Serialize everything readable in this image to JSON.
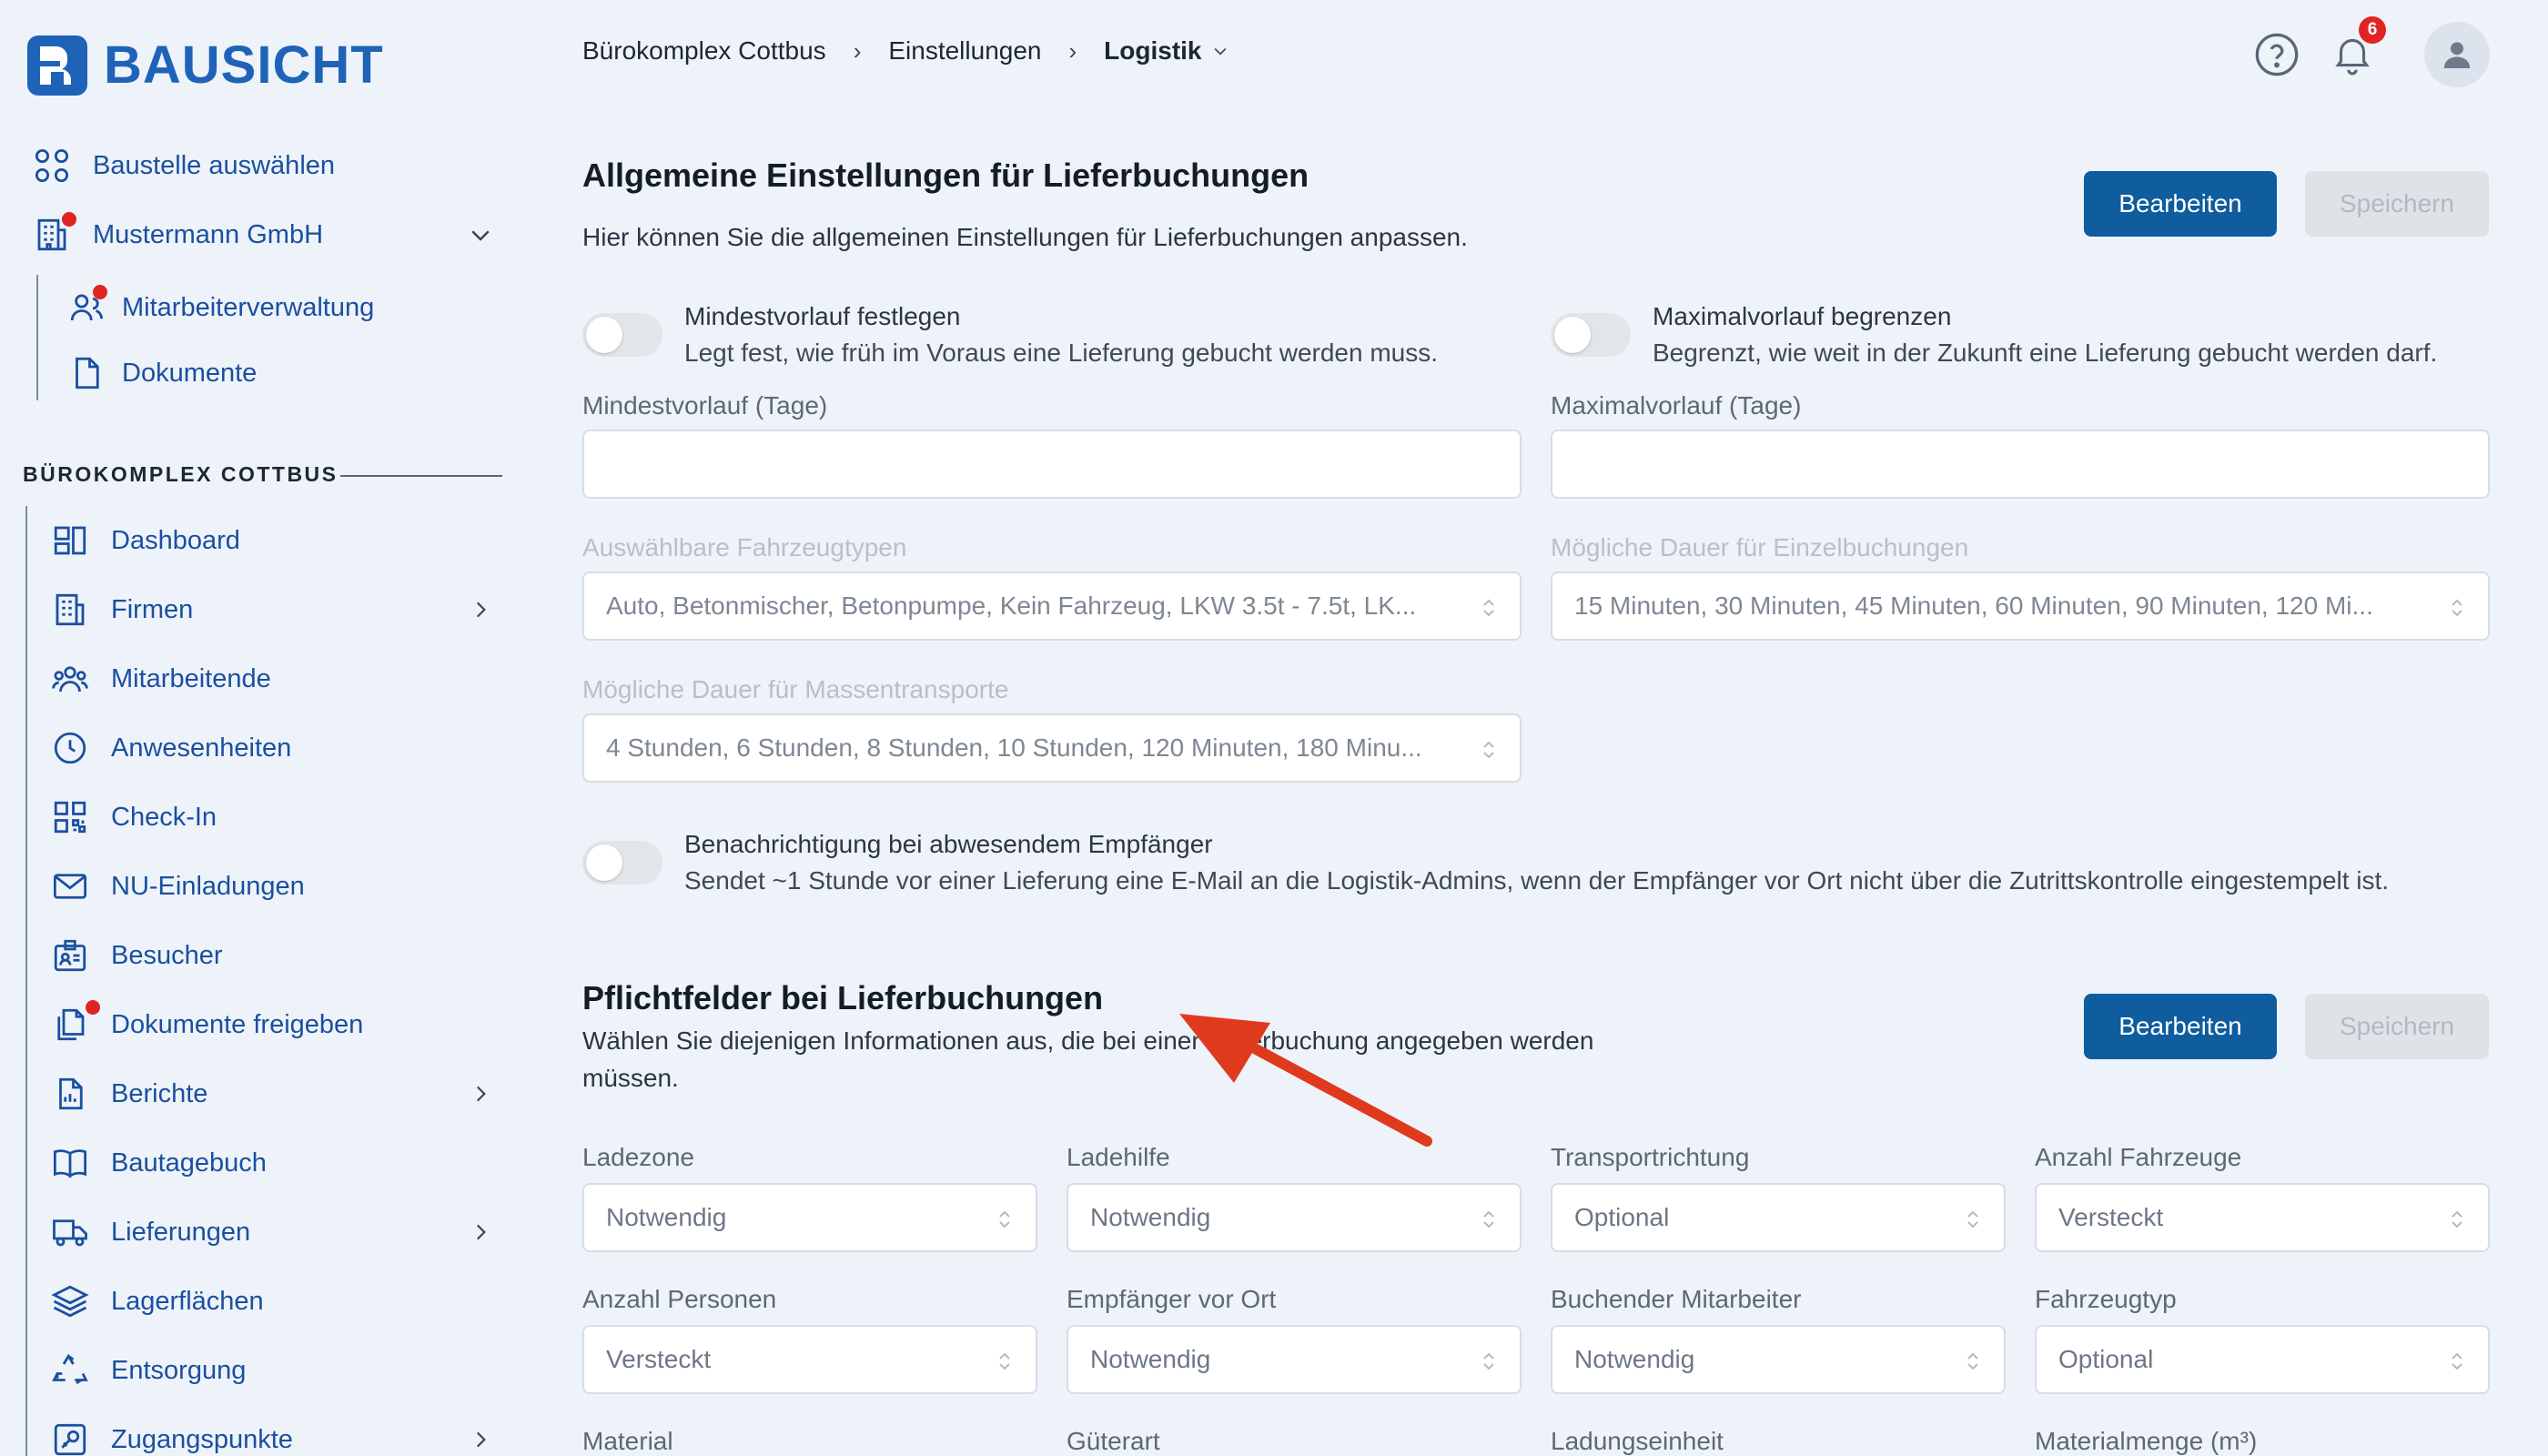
{
  "brand": {
    "name": "BAUSICHT",
    "color": "#1e63b8"
  },
  "sidebar": {
    "top_items": [
      {
        "label": "Baustelle auswählen",
        "icon": "grid-icon"
      },
      {
        "label": "Mustermann GmbH",
        "icon": "building-icon"
      },
      {
        "label": "Mitarbeiterverwaltung",
        "icon": "users-icon"
      },
      {
        "label": "Dokumente",
        "icon": "document-icon"
      }
    ],
    "section_title": "BÜROKOMPLEX COTTBUS",
    "items": [
      {
        "label": "Dashboard",
        "icon": "dashboard-icon"
      },
      {
        "label": "Firmen",
        "icon": "office-icon"
      },
      {
        "label": "Mitarbeitende",
        "icon": "team-icon"
      },
      {
        "label": "Anwesenheiten",
        "icon": "clock-icon"
      },
      {
        "label": "Check-In",
        "icon": "qr-icon"
      },
      {
        "label": "NU-Einladungen",
        "icon": "mail-icon"
      },
      {
        "label": "Besucher",
        "icon": "visitor-badge-icon"
      },
      {
        "label": "Dokumente freigeben",
        "icon": "documents-icon"
      },
      {
        "label": "Berichte",
        "icon": "report-icon"
      },
      {
        "label": "Bautagebuch",
        "icon": "book-icon"
      },
      {
        "label": "Lieferungen",
        "icon": "truck-icon"
      },
      {
        "label": "Lagerflächen",
        "icon": "layers-icon"
      },
      {
        "label": "Entsorgung",
        "icon": "recycle-icon"
      },
      {
        "label": "Zugangspunkte",
        "icon": "access-point-icon"
      }
    ]
  },
  "header": {
    "breadcrumb": [
      "Bürokomplex Cottbus",
      "Einstellungen",
      "Logistik"
    ],
    "notification_count": "6"
  },
  "general": {
    "title": "Allgemeine Einstellungen für Lieferbuchungen",
    "description": "Hier können Sie die allgemeinen Einstellungen für Lieferbuchungen anpassen.",
    "edit_label": "Bearbeiten",
    "save_label": "Speichern",
    "min_toggle_title": "Mindestvorlauf festlegen",
    "min_toggle_desc": "Legt fest, wie früh im Voraus eine Lieferung gebucht werden muss.",
    "max_toggle_title": "Maximalvorlauf begrenzen",
    "max_toggle_desc": "Begrenzt, wie weit in der Zukunft eine Lieferung gebucht werden darf.",
    "min_label": "Mindestvorlauf (Tage)",
    "min_value": "",
    "max_label": "Maximalvorlauf (Tage)",
    "max_value": "",
    "vehicle_label": "Auswählbare Fahrzeugtypen",
    "vehicle_value": "Auto, Betonmischer, Betonpumpe, Kein Fahrzeug, LKW 3.5t - 7.5t, LK...",
    "single_label": "Mögliche Dauer für Einzelbuchungen",
    "single_value": "15 Minuten, 30 Minuten, 45 Minuten, 60 Minuten, 90 Minuten, 120 Mi...",
    "mass_label": "Mögliche Dauer für Massentransporte",
    "mass_value": "4 Stunden, 6 Stunden, 8 Stunden, 10 Stunden, 120 Minuten, 180 Minu...",
    "notify_title": "Benachrichtigung bei abwesendem Empfänger",
    "notify_desc": "Sendet ~1 Stunde vor einer Lieferung eine E-Mail an die Logistik-Admins, wenn der Empfänger vor Ort nicht über die Zutrittskontrolle eingestempelt ist."
  },
  "required": {
    "title": "Pflichtfelder bei Lieferbuchungen",
    "description_line1": "Wählen Sie diejenigen Informationen aus, die bei einer Lieferbuchung angegeben werden",
    "description_line2": "müssen.",
    "edit_label": "Bearbeiten",
    "save_label": "Speichern",
    "fields": [
      {
        "label": "Ladezone",
        "value": "Notwendig"
      },
      {
        "label": "Ladehilfe",
        "value": "Notwendig"
      },
      {
        "label": "Transportrichtung",
        "value": "Optional"
      },
      {
        "label": "Anzahl Fahrzeuge",
        "value": "Versteckt"
      },
      {
        "label": "Anzahl Personen",
        "value": "Versteckt"
      },
      {
        "label": "Empfänger vor Ort",
        "value": "Notwendig"
      },
      {
        "label": "Buchender Mitarbeiter",
        "value": "Notwendig"
      },
      {
        "label": "Fahrzeugtyp",
        "value": "Optional"
      },
      {
        "label": "Material",
        "value": ""
      },
      {
        "label": "Güterart",
        "value": ""
      },
      {
        "label": "Ladungseinheit",
        "value": ""
      },
      {
        "label": "Materialmenge (m³)",
        "value": ""
      }
    ]
  },
  "colors": {
    "primary": "#0f5c9e",
    "accent_red": "#e02424",
    "nav_text": "#1b4fa0",
    "annotation_arrow": "#e03a1e"
  }
}
